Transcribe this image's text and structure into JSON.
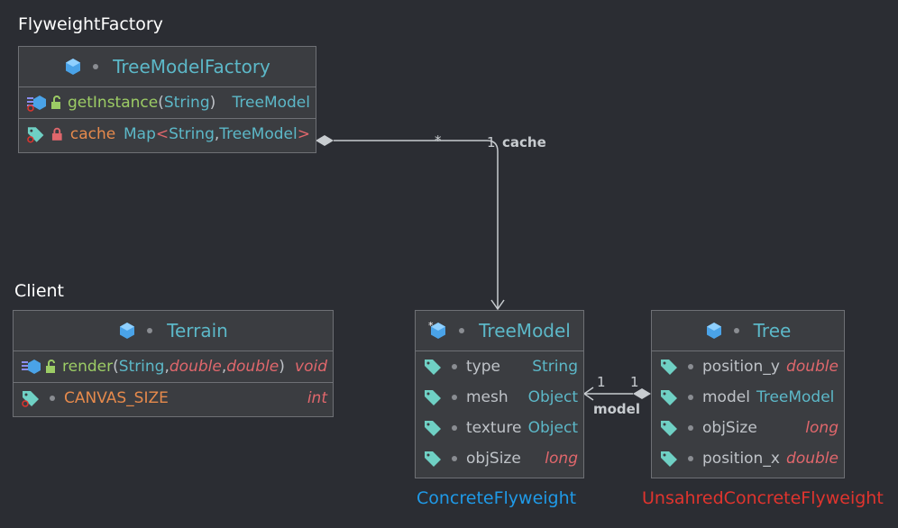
{
  "captions": {
    "factory": "FlyweightFactory",
    "client": "Client",
    "concrete": "ConcreteFlyweight",
    "unshared": "UnsahredConcreteFlyweight"
  },
  "factory": {
    "title": "TreeModelFactory",
    "method_name": "getInstance",
    "method_paren_open": "(",
    "method_param": "String",
    "method_paren_close": ")",
    "method_return": "TreeModel",
    "field_name": "cache",
    "field_type_prefix": "Map",
    "field_lt": "<",
    "field_t1": "String",
    "field_comma": ", ",
    "field_t2": "TreeModel",
    "field_gt": ">"
  },
  "terrain": {
    "title": "Terrain",
    "method_name": "render",
    "p_open": "(",
    "p1": "String",
    "c1": ", ",
    "p2": "double",
    "c2": ", ",
    "p3": "double",
    "p_close": ")",
    "method_return": "void",
    "field_name": "CANVAS_SIZE",
    "field_type": "int"
  },
  "treemodel": {
    "title": "TreeModel",
    "fields": [
      {
        "name": "type",
        "type": "String"
      },
      {
        "name": "mesh",
        "type": "Object"
      },
      {
        "name": "texture",
        "type": "Object"
      },
      {
        "name": "objSize",
        "type": "long"
      }
    ]
  },
  "tree": {
    "title": "Tree",
    "fields": [
      {
        "name": "position_y",
        "type": "double"
      },
      {
        "name": "model",
        "type": "TreeModel"
      },
      {
        "name": "objSize",
        "type": "long"
      },
      {
        "name": "position_x",
        "type": "double"
      }
    ]
  },
  "assoc_cache": {
    "label": "cache",
    "src_mult": "*",
    "dst_mult": "1"
  },
  "assoc_model": {
    "label": "model",
    "src_mult": "1",
    "dst_mult": "1"
  },
  "colors": {
    "background": "#2b2d33",
    "box": "#3b3d41",
    "title": "#5cb8c8",
    "method": "#9ccc65",
    "field": "#e68a4c",
    "primitive": "#e0676c",
    "concrete_caption": "#1f9ae8",
    "unshared_caption": "#e0342e"
  },
  "icons": [
    "class-icon",
    "method-icon",
    "field-icon",
    "public-lock-icon",
    "private-lock-icon",
    "static-class-icon"
  ]
}
